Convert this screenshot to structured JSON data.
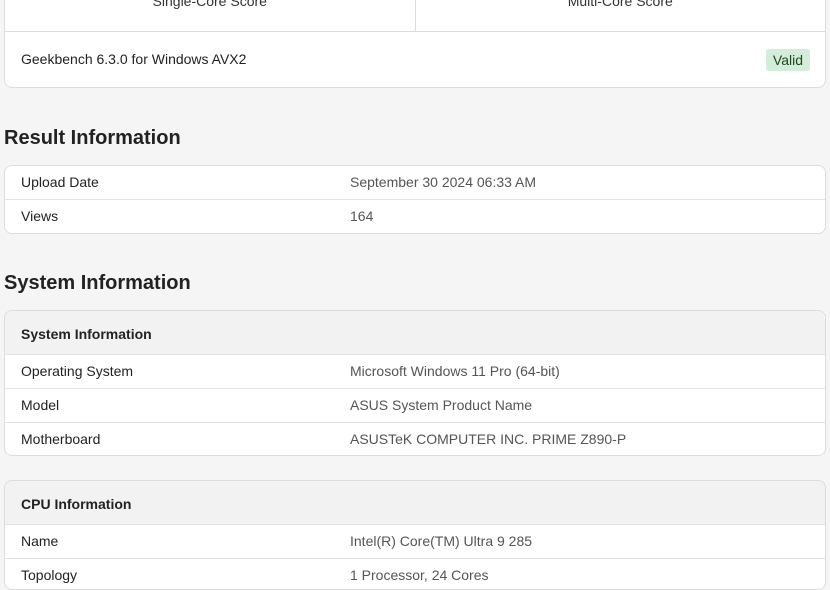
{
  "scores": {
    "single_core_label": "Single-Core Score",
    "multi_core_label": "Multi-Core Score",
    "version": "Geekbench 6.3.0 for Windows AVX2",
    "badge": "Valid"
  },
  "result_info": {
    "title": "Result Information",
    "rows": [
      {
        "key": "Upload Date",
        "value": "September 30 2024 06:33 AM"
      },
      {
        "key": "Views",
        "value": "164"
      }
    ]
  },
  "system_info": {
    "title": "System Information",
    "system_card": {
      "header": "System Information",
      "rows": [
        {
          "key": "Operating System",
          "value": "Microsoft Windows 11 Pro (64-bit)"
        },
        {
          "key": "Model",
          "value": "ASUS System Product Name"
        },
        {
          "key": "Motherboard",
          "value": "ASUSTeK COMPUTER INC. PRIME Z890-P"
        }
      ]
    },
    "cpu_card": {
      "header": "CPU Information",
      "rows": [
        {
          "key": "Name",
          "value": "Intel(R) Core(TM) Ultra 9 285"
        },
        {
          "key": "Topology",
          "value": "1 Processor, 24 Cores"
        }
      ]
    }
  }
}
